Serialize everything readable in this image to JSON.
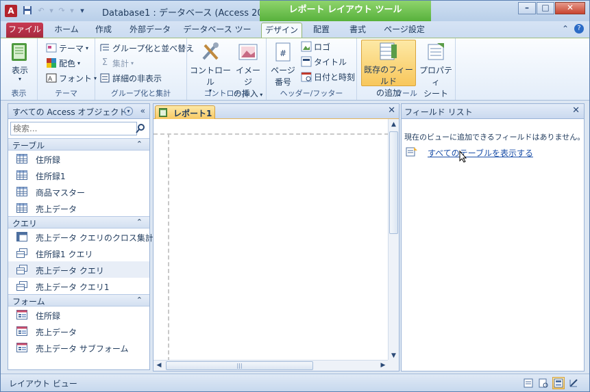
{
  "window": {
    "app_icon_letter": "A",
    "title": "Database1 : データベース (Access 200...",
    "context_title": "レポート レイアウト ツール"
  },
  "tabs": {
    "file": "ファイル",
    "home": "ホーム",
    "create": "作成",
    "external": "外部データ",
    "dbtools": "データベース ツール",
    "design": "デザイン",
    "arrange": "配置",
    "format": "書式",
    "pagesetup": "ページ設定"
  },
  "ribbon": {
    "view": {
      "label": "表示",
      "group": "表示"
    },
    "theme": {
      "themes": "テーマ",
      "colors": "配色",
      "fonts": "フォント",
      "group": "テーマ"
    },
    "grouping": {
      "group_sort": "グループ化と並べ替え",
      "totals": "集計",
      "hide_details": "詳細の非表示",
      "group": "グループ化と集計"
    },
    "controls": {
      "controls": "コントロール",
      "insert_image_1": "イメージ",
      "insert_image_2": "の挿入",
      "group": "コントロール"
    },
    "header_footer": {
      "page_num_1": "ページ",
      "page_num_2": "番号",
      "logo": "ロゴ",
      "title": "タイトル",
      "datetime": "日付と時刻",
      "group": "ヘッダー/フッター"
    },
    "tools": {
      "add_fields_1": "既存のフィールド",
      "add_fields_2": "の追加",
      "property_1": "プロパティ",
      "property_2": "シート",
      "group": "ツール"
    }
  },
  "nav": {
    "title": "すべての Access オブジェクト",
    "search_placeholder": "検索...",
    "groups": [
      {
        "label": "テーブル",
        "items": [
          "住所録",
          "住所録1",
          "商品マスター",
          "売上データ"
        ]
      },
      {
        "label": "クエリ",
        "items": [
          "売上データ クエリのクロス集計",
          "住所録1 クエリ",
          "売上データ クエリ",
          "売上データ クエリ1"
        ]
      },
      {
        "label": "フォーム",
        "items": [
          "住所録",
          "売上データ",
          "売上データ サブフォーム"
        ]
      }
    ]
  },
  "document": {
    "tab_label": "レポート1"
  },
  "fieldlist": {
    "title": "フィールド リスト",
    "message": "現在のビューに追加できるフィールドはありません。",
    "link": "すべてのテーブルを表示する"
  },
  "status": {
    "text": "レイアウト ビュー"
  },
  "colors": {
    "context_green": "#57b13c",
    "file_tab": "#a52a3e",
    "highlight": "#f7c964"
  }
}
